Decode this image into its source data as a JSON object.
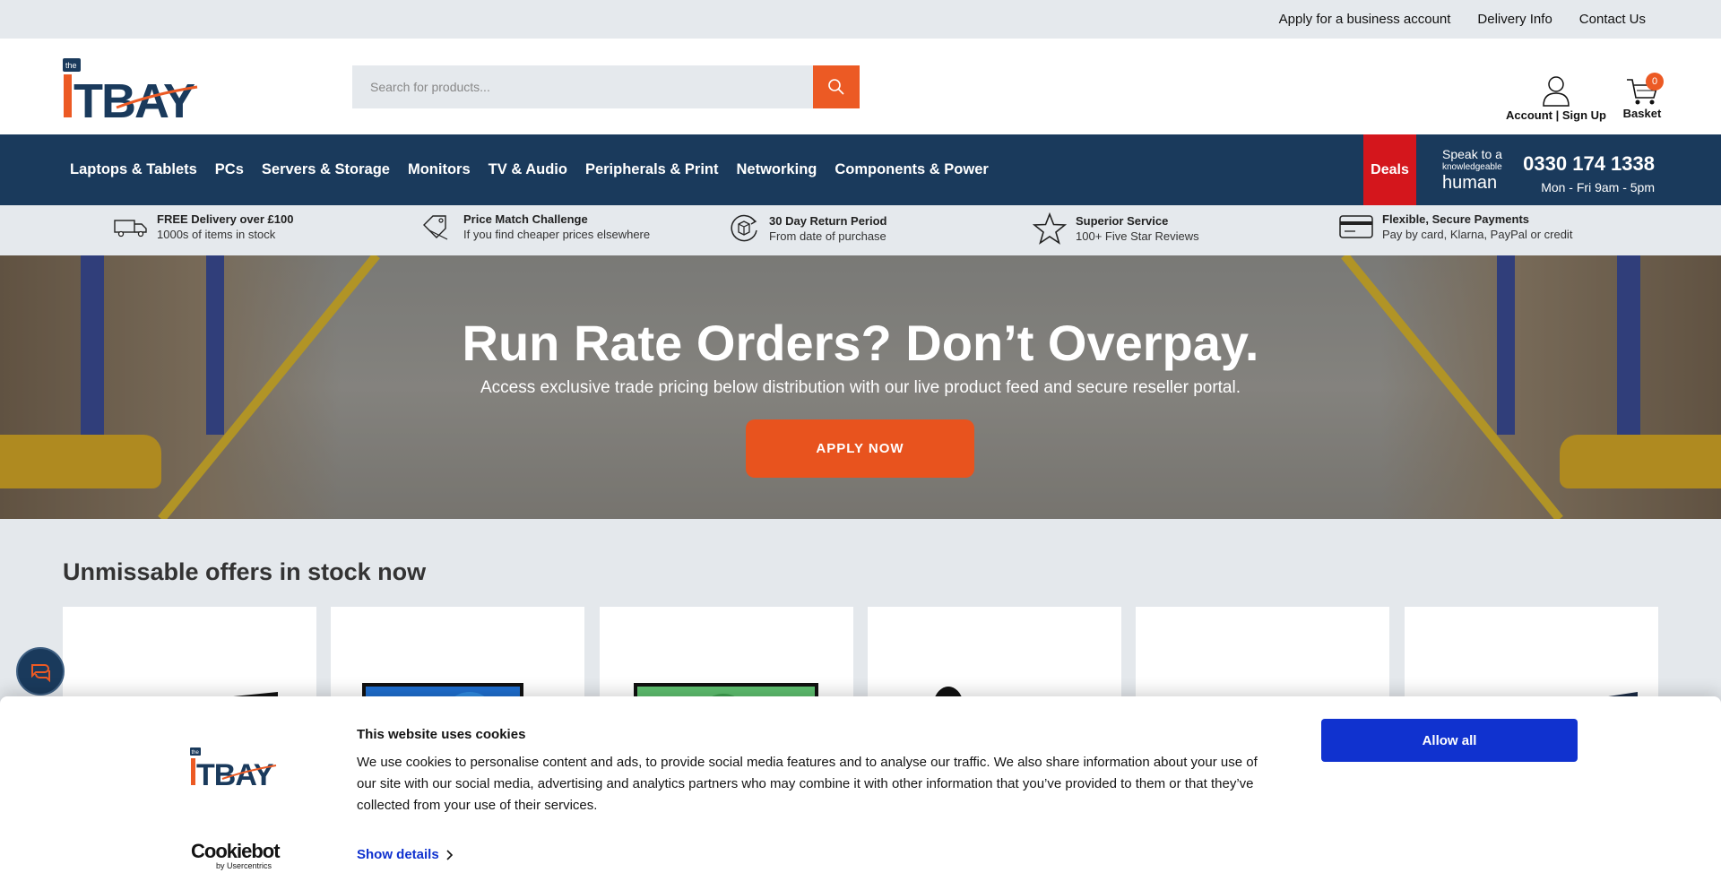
{
  "topbar": {
    "links": [
      "Apply for a business account",
      "Delivery Info",
      "Contact Us"
    ]
  },
  "header": {
    "logo_small": "the",
    "logo_text": "ITBAY",
    "search_placeholder": "Search for products...",
    "account_label": "Account | Sign Up",
    "basket_label": "Basket",
    "basket_count": "0"
  },
  "nav": {
    "items": [
      "Laptops & Tablets",
      "PCs",
      "Servers & Storage",
      "Monitors",
      "TV & Audio",
      "Peripherals & Print",
      "Networking",
      "Components & Power"
    ],
    "deals": "Deals",
    "speak_line1": "Speak to a",
    "speak_line2": "knowledgeable",
    "speak_line3": "human",
    "phone": "0330 174 1338",
    "hours": "Mon - Fri 9am - 5pm"
  },
  "usps": [
    {
      "title": "FREE Delivery over £100",
      "sub": "1000s of items in stock",
      "icon": "truck-icon"
    },
    {
      "title": "Price Match Challenge",
      "sub": "If you find cheaper prices elsewhere",
      "icon": "price-tag-icon"
    },
    {
      "title": "30 Day Return Period",
      "sub": "From date of purchase",
      "icon": "return-box-icon"
    },
    {
      "title": "Superior Service",
      "sub": "100+ Five Star Reviews",
      "icon": "star-icon"
    },
    {
      "title": "Flexible, Secure Payments",
      "sub": "Pay by card, Klarna, PayPal or credit",
      "icon": "credit-card-icon"
    }
  ],
  "hero": {
    "title": "Run Rate Orders? Don’t Overpay.",
    "subtitle": "Access exclusive trade pricing below distribution with our live product feed and secure reseller portal.",
    "cta": "APPLY NOW"
  },
  "offers": {
    "title": "Unmissable offers in stock now"
  },
  "cookie": {
    "title": "This website uses cookies",
    "body": "We use cookies to personalise content and ads, to provide social media features and to analyse our traffic. We also share information about your use of our site with our social media, advertising and analytics partners who may combine it with other information that you’ve provided to them or that they’ve collected from your use of their services.",
    "show_details": "Show details",
    "allow_all": "Allow all",
    "cookiebot": "Cookiebot",
    "cookiebot_sub": "by Usercentrics"
  },
  "colors": {
    "navy": "#1a3a5c",
    "orange": "#ec5a24",
    "deals_red": "#d4161c",
    "cookie_blue": "#1032cf"
  }
}
